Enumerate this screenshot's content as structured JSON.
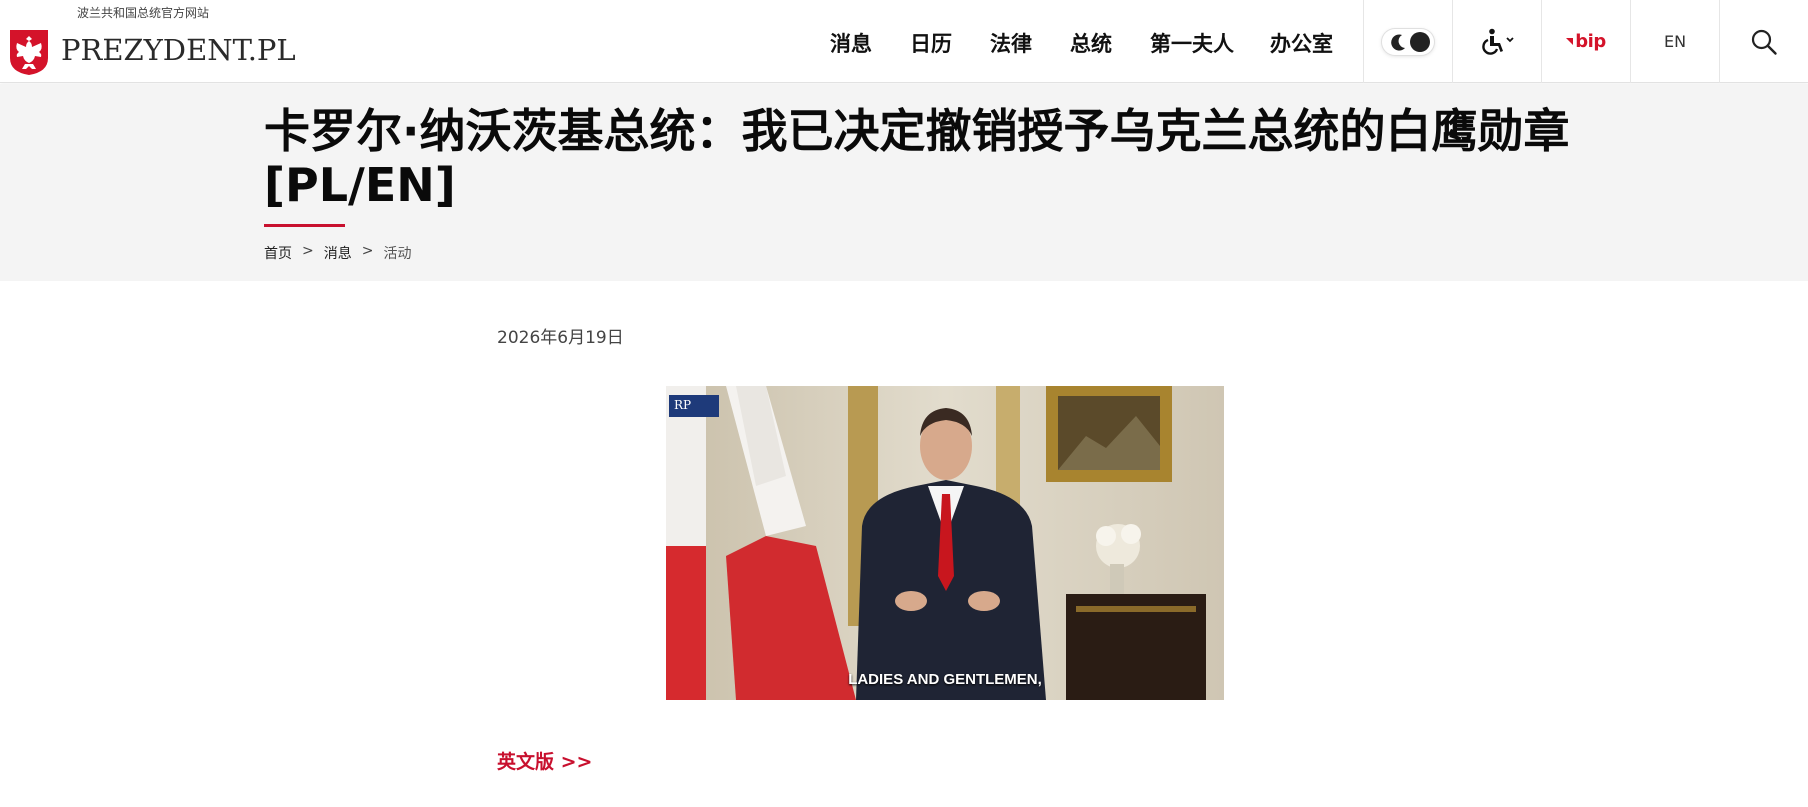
{
  "header": {
    "tagline": "波兰共和国总统官方网站",
    "logo_text": "PREZYDENT.PL",
    "nav": [
      "消息",
      "日历",
      "法律",
      "总统",
      "第一夫人",
      "办公室"
    ],
    "bip_label": "bip",
    "lang_label": "EN"
  },
  "article": {
    "title": "卡罗尔·纳沃茨基总统：我已决定撤销授予乌克兰总统的白鹰勋章 [PL/EN]",
    "breadcrumb": {
      "home": "首页",
      "news": "消息",
      "current": "活动",
      "separator": ">"
    },
    "date": "2026年6月19日",
    "video_caption": "LADIES AND GENTLEMEN,",
    "video_badge": "RP",
    "english_link": "英文版 >>"
  },
  "colors": {
    "accent": "#c8102e",
    "band": "#f4f4f4"
  }
}
